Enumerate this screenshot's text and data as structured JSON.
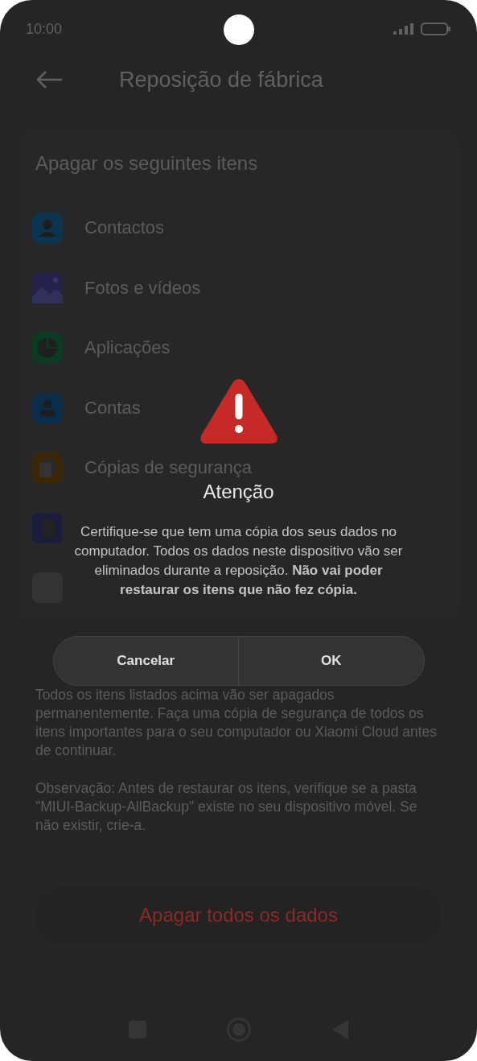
{
  "status_bar": {
    "time": "10:00"
  },
  "header": {
    "title": "Reposição de fábrica"
  },
  "section": {
    "title": "Apagar os seguintes itens",
    "items": [
      {
        "kind": "contacts",
        "label": "Contactos"
      },
      {
        "kind": "photos",
        "label": "Fotos e vídeos"
      },
      {
        "kind": "apps",
        "label": "Aplicações"
      },
      {
        "kind": "accounts",
        "label": "Contas"
      },
      {
        "kind": "backups",
        "label": "Cópias de segurança"
      },
      {
        "kind": "sd"
      },
      {
        "kind": "other"
      }
    ]
  },
  "notes": [
    "Todos os itens listados acima vão ser apagados permanentemente. Faça uma cópia de segurança de todos os itens importantes para o seu computador ou Xiaomi Cloud antes de continuar.",
    "Observação: Antes de restaurar os itens, verifique se a pasta \"MIUI-Backup-AllBackup\" existe no seu dispositivo móvel. Se não existir, crie-a."
  ],
  "action_button": "Apagar todos os dados",
  "dialog": {
    "title": "Atenção",
    "message": "Certifique-se que tem uma cópia dos seus dados no computador. Todos os dados neste dispositivo vão ser eliminados durante a reposição. **Não vai poder restaurar os itens que não fez cópia.**",
    "buttons": [
      "Cancelar",
      "OK"
    ]
  }
}
